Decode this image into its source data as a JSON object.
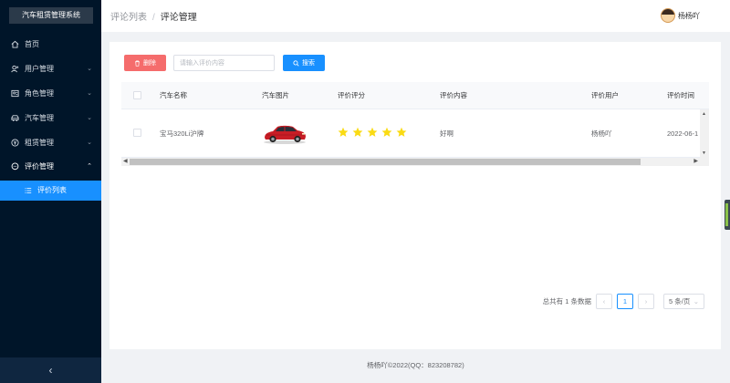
{
  "sidebar": {
    "logo": "汽车租赁管理系统",
    "items": [
      {
        "label": "首页",
        "icon": "home-icon"
      },
      {
        "label": "用户管理",
        "icon": "user-icon"
      },
      {
        "label": "角色管理",
        "icon": "role-icon"
      },
      {
        "label": "汽车管理",
        "icon": "car-icon"
      },
      {
        "label": "租赁管理",
        "icon": "rental-icon"
      },
      {
        "label": "评价管理",
        "icon": "comment-icon"
      }
    ],
    "sub_item": {
      "label": "评价列表",
      "icon": "list-icon"
    },
    "collapse_icon": "‹"
  },
  "header": {
    "breadcrumb": [
      "评论列表",
      "评论管理"
    ],
    "separator": "/",
    "user_name": "杨杨吖"
  },
  "toolbar": {
    "delete_label": "删除",
    "search_placeholder": "请输入评价内容",
    "search_value": "",
    "search_label": "搜索"
  },
  "table": {
    "columns": [
      "汽车名称",
      "汽车图片",
      "评价评分",
      "评价内容",
      "评价用户",
      "评价时间"
    ],
    "rows": [
      {
        "car_name": "宝马320Li沪牌",
        "car_image": "red-sedan",
        "rating": 5,
        "content": "好啊",
        "user": "杨杨吖",
        "time": "2022-06-1"
      }
    ]
  },
  "pagination": {
    "total_text": "总共有 1 条数据",
    "current_page": "1",
    "page_size": "5 条/页"
  },
  "footer": "杨杨吖©2022(QQ：823208782)",
  "colors": {
    "sidebar": "#001529",
    "active": "#1890ff",
    "danger": "#f56c6c",
    "star": "#fadb14"
  }
}
